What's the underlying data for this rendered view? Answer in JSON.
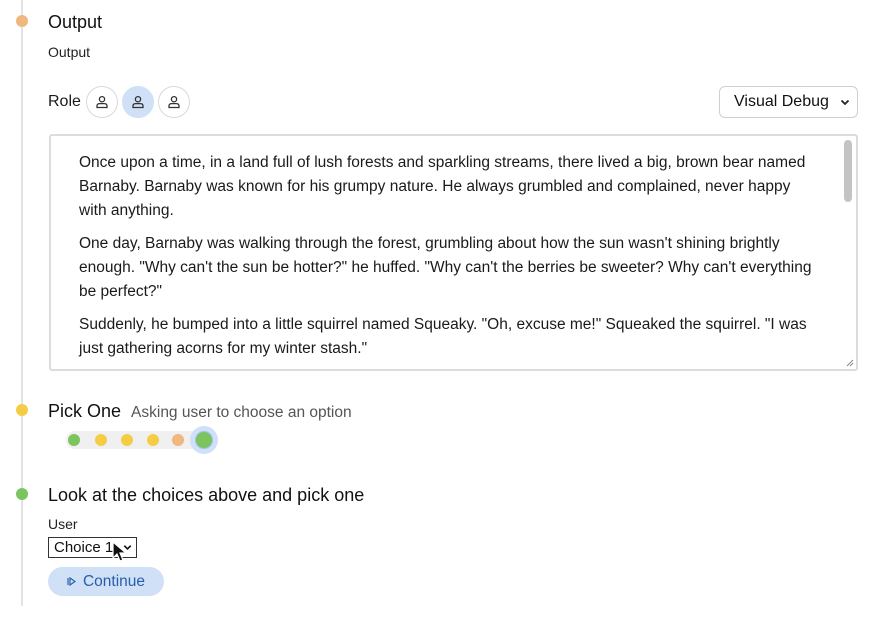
{
  "output": {
    "title": "Output",
    "subtitle": "Output"
  },
  "role": {
    "label": "Role",
    "buttons": [
      {
        "icon": "person-icon",
        "active": false
      },
      {
        "icon": "person-icon",
        "active": true
      },
      {
        "icon": "person-icon",
        "active": false
      }
    ]
  },
  "debug_select": {
    "value": "Visual Debug",
    "icon": "chevron-down-icon"
  },
  "story": {
    "paragraphs": [
      "Once upon a time, in a land full of lush forests and sparkling streams, there lived a big, brown bear named Barnaby. Barnaby was known for his grumpy nature. He always grumbled and complained, never happy with anything.",
      "One day, Barnaby was walking through the forest, grumbling about how the sun wasn't shining brightly enough. \"Why can't the sun be hotter?\" he huffed. \"Why can't the berries be sweeter? Why can't everything be perfect?\"",
      "Suddenly, he bumped into a little squirrel named Squeaky. \"Oh, excuse me!\" Squeaked the squirrel. \"I was just gathering acorns for my winter stash.\""
    ]
  },
  "pick_one": {
    "title": "Pick One",
    "subtitle": "Asking user to choose an option"
  },
  "steps": [
    {
      "status": "green",
      "color": "#7cc45d"
    },
    {
      "status": "yellow",
      "color": "#f5cc45"
    },
    {
      "status": "yellow",
      "color": "#f5cc45"
    },
    {
      "status": "yellow",
      "color": "#f5cc45"
    },
    {
      "status": "orange",
      "color": "#f0b77e"
    },
    {
      "status": "current",
      "color": "#7cc45d"
    }
  ],
  "choice_section": {
    "title": "Look at the choices above and pick one",
    "label": "User",
    "select_value": "Choice 1"
  },
  "continue_button": {
    "label": "Continue",
    "icon": "play-icon"
  },
  "colors": {
    "accent": "#cfe0f7",
    "accent_text": "#2a5ea8",
    "timeline_orange": "#f0b77e",
    "timeline_yellow": "#f5cc45",
    "timeline_green": "#7cc45d"
  }
}
